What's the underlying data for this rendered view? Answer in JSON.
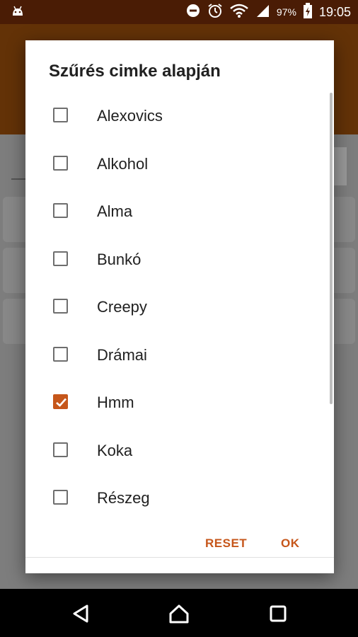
{
  "status_bar": {
    "battery": "97%",
    "time": "19:05",
    "icons": [
      "android-icon",
      "dnd-icon",
      "alarm-icon",
      "wifi-icon",
      "signal-icon",
      "battery-charging-icon"
    ]
  },
  "dialog": {
    "title": "Szűrés cimke alapján",
    "items": [
      {
        "label": "Alexovics",
        "checked": false
      },
      {
        "label": "Alkohol",
        "checked": false
      },
      {
        "label": "Alma",
        "checked": false
      },
      {
        "label": "Bunkó",
        "checked": false
      },
      {
        "label": "Creepy",
        "checked": false
      },
      {
        "label": "Drámai",
        "checked": false
      },
      {
        "label": "Hmm",
        "checked": true
      },
      {
        "label": "Koka",
        "checked": false
      },
      {
        "label": "Részeg",
        "checked": false
      }
    ],
    "actions": {
      "reset": "RESET",
      "ok": "OK"
    }
  },
  "colors": {
    "accent": "#c6561a",
    "appbar": "#633207",
    "statusbar": "#4a1c05"
  },
  "nav": [
    "back-icon",
    "home-icon",
    "recents-icon"
  ]
}
